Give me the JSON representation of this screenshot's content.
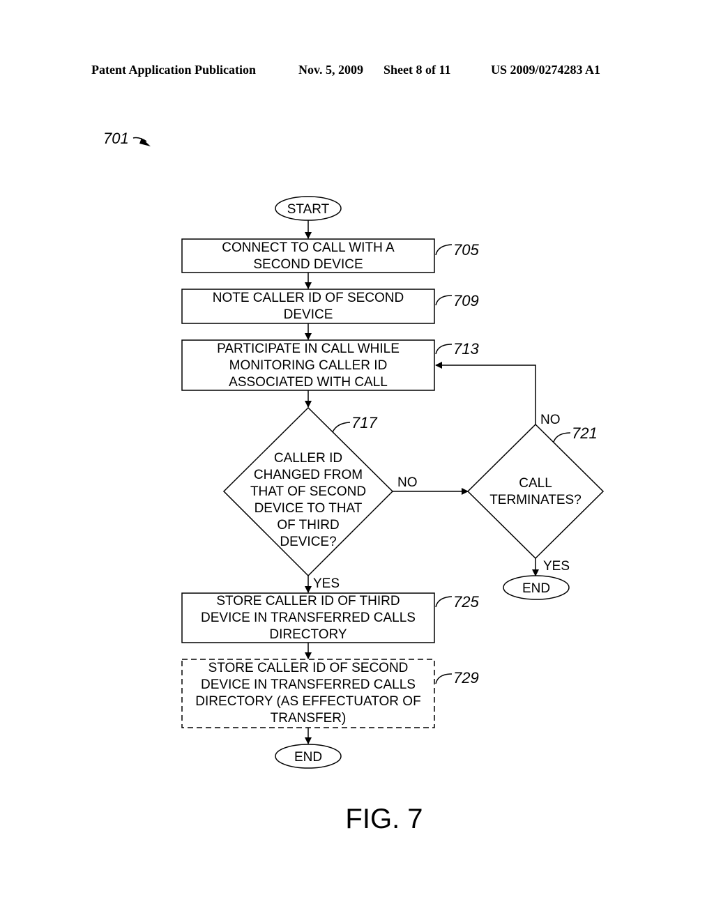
{
  "header": {
    "publication": "Patent Application Publication",
    "date": "Nov. 5, 2009",
    "sheet": "Sheet 8 of 11",
    "number": "US 2009/0274283 A1"
  },
  "figure": {
    "label": "FIG. 7",
    "ref": "701"
  },
  "nodes": {
    "start": "START",
    "n705": {
      "ref": "705",
      "lines": [
        "CONNECT TO CALL WITH A",
        "SECOND DEVICE"
      ]
    },
    "n709": {
      "ref": "709",
      "lines": [
        "NOTE CALLER ID OF SECOND",
        "DEVICE"
      ]
    },
    "n713": {
      "ref": "713",
      "lines": [
        "PARTICIPATE IN CALL WHILE",
        "MONITORING CALLER ID",
        "ASSOCIATED WITH CALL"
      ]
    },
    "n717": {
      "ref": "717",
      "lines": [
        "CALLER ID",
        "CHANGED FROM",
        "THAT OF SECOND",
        "DEVICE TO THAT",
        "OF THIRD",
        "DEVICE?"
      ]
    },
    "n721": {
      "ref": "721",
      "lines": [
        "CALL",
        "TERMINATES?"
      ]
    },
    "n725": {
      "ref": "725",
      "lines": [
        "STORE CALLER ID OF THIRD",
        "DEVICE IN TRANSFERRED CALLS",
        "DIRECTORY"
      ]
    },
    "n729": {
      "ref": "729",
      "lines": [
        "STORE CALLER ID OF SECOND",
        "DEVICE IN TRANSFERRED CALLS",
        "DIRECTORY (AS EFFECTUATOR OF",
        "TRANSFER)"
      ]
    },
    "end_right": "END",
    "end_bottom": "END"
  },
  "edges": {
    "n717_no": "NO",
    "n717_yes": "YES",
    "n721_no": "NO",
    "n721_yes": "YES"
  }
}
